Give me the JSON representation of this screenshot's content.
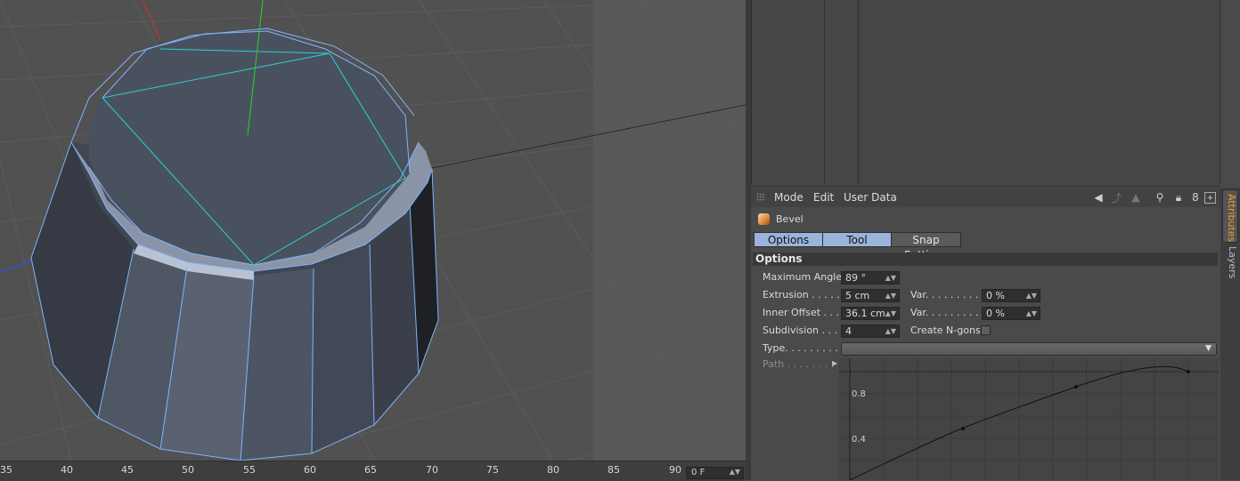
{
  "timeline": {
    "ticks": [
      "35",
      "40",
      "45",
      "50",
      "55",
      "60",
      "65",
      "70",
      "75",
      "80",
      "85",
      "90"
    ],
    "current_frame": "0 F"
  },
  "attributes": {
    "menu": {
      "mode": "Mode",
      "edit": "Edit",
      "user_data": "User Data"
    },
    "object_title": "Bevel",
    "tabs": {
      "options": "Options",
      "tool": "Tool",
      "snap": "Snap Settings"
    },
    "section_title": "Options",
    "fields": {
      "max_angle_label": "Maximum Angle",
      "max_angle_value": "89 °",
      "extrusion_label": "Extrusion . . . . . .",
      "extrusion_value": "5 cm",
      "extrusion_var_label": "Var. . . . . . . . . . .",
      "extrusion_var_value": "0 %",
      "inner_offset_label": "Inner Offset . . . .",
      "inner_offset_value": "36.1 cm",
      "inner_offset_var_label": "Var. . . . . . . . . . .",
      "inner_offset_var_value": "0 %",
      "subdivision_label": "Subdivision . . . .",
      "subdivision_value": "4",
      "create_ngons_label": "Create N-gons",
      "type_label": "Type. . . . . . . . . .",
      "path_label": "Path . . . . . . . ."
    },
    "curve": {
      "y_ticks": [
        "0.8",
        "0.4"
      ]
    }
  },
  "side_tabs": {
    "attributes": "Attributes",
    "layers": "Layers"
  }
}
